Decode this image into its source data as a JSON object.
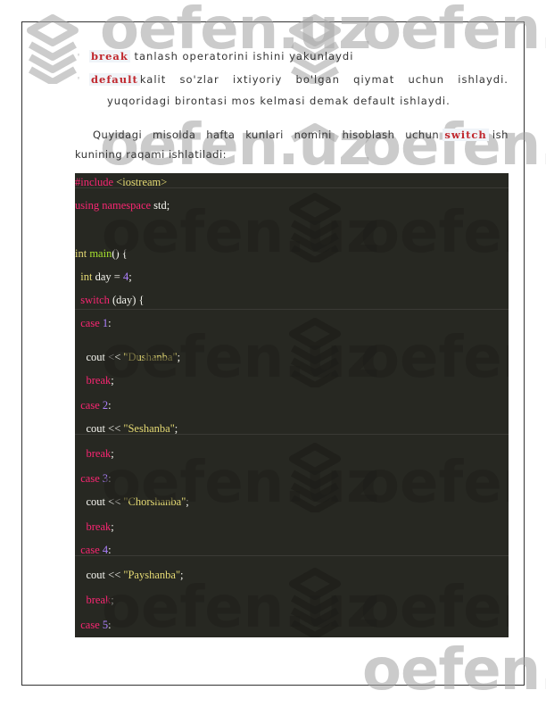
{
  "watermark": {
    "text": "oefen.uz"
  },
  "bullets": [
    {
      "keyword": "break",
      "text": " tanlash operatorini ishini yakunlaydi"
    },
    {
      "keyword": "default",
      "text_words": [
        "kalit",
        "so'zlar",
        "ixtiyoriy",
        "bo'lgan",
        "qiymat",
        "uchun",
        "ishlaydi."
      ],
      "continuation": "yuqoridagi birontasi mos kelmasi demak default ishlaydi."
    }
  ],
  "paragraph": {
    "words": [
      "Quyidagi",
      "misolda",
      "hafta",
      "kunlari",
      "nomini",
      "hisoblash",
      "uchun"
    ],
    "keyword": "switch",
    "after_keyword": " ish",
    "line2": "kunining raqami ishlatiladi:"
  },
  "code": {
    "lines": [
      [
        {
          "t": "#include ",
          "c": "pink"
        },
        {
          "t": "<iostream>",
          "c": "yellow"
        }
      ],
      [
        {
          "t": "using namespace ",
          "c": "pink"
        },
        {
          "t": "std;",
          "c": "white"
        }
      ],
      [],
      [
        {
          "t": "int ",
          "c": "yellow"
        },
        {
          "t": "main",
          "c": "green"
        },
        {
          "t": "() {",
          "c": "white"
        }
      ],
      [
        {
          "t": "  int ",
          "c": "yellow"
        },
        {
          "t": "day = ",
          "c": "white"
        },
        {
          "t": "4",
          "c": "purple"
        },
        {
          "t": ";",
          "c": "white"
        }
      ],
      [
        {
          "t": "  switch ",
          "c": "pink"
        },
        {
          "t": "(day) {",
          "c": "white"
        }
      ],
      [
        {
          "t": "  case ",
          "c": "pink"
        },
        {
          "t": "1",
          "c": "purple"
        },
        {
          "t": ":",
          "c": "white"
        }
      ],
      [
        {
          "t": "    cout << ",
          "c": "white"
        },
        {
          "t": "\"Dushanba\"",
          "c": "yellow"
        },
        {
          "t": ";",
          "c": "white"
        }
      ],
      [
        {
          "t": "    break",
          "c": "pink"
        },
        {
          "t": ";",
          "c": "white"
        }
      ],
      [
        {
          "t": "  case ",
          "c": "pink"
        },
        {
          "t": "2",
          "c": "purple"
        },
        {
          "t": ":",
          "c": "white"
        }
      ],
      [
        {
          "t": "    cout << ",
          "c": "white"
        },
        {
          "t": "\"Seshanba\"",
          "c": "yellow"
        },
        {
          "t": ";",
          "c": "white"
        }
      ],
      [
        {
          "t": "    break",
          "c": "pink"
        },
        {
          "t": ";",
          "c": "white"
        }
      ],
      [
        {
          "t": "  case ",
          "c": "pink"
        },
        {
          "t": "3",
          "c": "purple"
        },
        {
          "t": ":",
          "c": "white"
        }
      ],
      [
        {
          "t": "    cout << ",
          "c": "white"
        },
        {
          "t": "\"Chorshanba\"",
          "c": "yellow"
        },
        {
          "t": ";",
          "c": "white"
        }
      ],
      [
        {
          "t": "    break",
          "c": "pink"
        },
        {
          "t": ";",
          "c": "white"
        }
      ],
      [
        {
          "t": "  case ",
          "c": "pink"
        },
        {
          "t": "4",
          "c": "purple"
        },
        {
          "t": ":",
          "c": "white"
        }
      ],
      [
        {
          "t": "    cout << ",
          "c": "white"
        },
        {
          "t": "\"Payshanba\"",
          "c": "yellow"
        },
        {
          "t": ";",
          "c": "white"
        }
      ],
      [
        {
          "t": "    break",
          "c": "pink"
        },
        {
          "t": ";",
          "c": "white"
        }
      ],
      [
        {
          "t": "  case ",
          "c": "pink"
        },
        {
          "t": "5",
          "c": "purple"
        },
        {
          "t": ":",
          "c": "white"
        }
      ]
    ]
  }
}
